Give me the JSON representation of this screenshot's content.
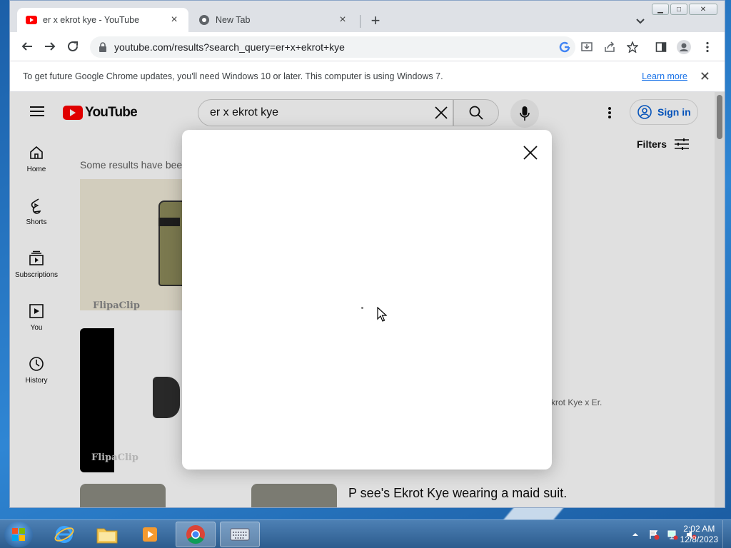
{
  "browser": {
    "tabs": [
      {
        "title": "er x ekrot kye - YouTube",
        "active": true
      },
      {
        "title": "New Tab",
        "active": false
      }
    ],
    "address": "youtube.com/results?search_query=er+x+ekrot+kye",
    "infobar": {
      "message": "To get future Google Chrome updates, you'll need Windows 10 or later. This computer is using Windows 7.",
      "link": "Learn more"
    }
  },
  "youtube": {
    "logo": "YouTube",
    "search_value": "er x ekrot kye",
    "sign_in": "Sign in",
    "filters": "Filters",
    "guide": [
      {
        "label": "Home",
        "icon": "home-icon"
      },
      {
        "label": "Shorts",
        "icon": "shorts-icon"
      },
      {
        "label": "Subscriptions",
        "icon": "subscriptions-icon"
      },
      {
        "label": "You",
        "icon": "you-icon"
      },
      {
        "label": "History",
        "icon": "history-icon"
      }
    ],
    "notice": "Some results have been",
    "watermark1": "FlipaClip",
    "watermark2": "FlipaClip",
    "snippet": "krot Kye x Er.",
    "video_title": "P see's Ekrot Kye wearing a maid suit."
  },
  "taskbar": {
    "time": "2:02 AM",
    "date": "12/8/2023",
    "apps": [
      "internet-explorer",
      "file-explorer",
      "media-player",
      "chrome",
      "on-screen-keyboard"
    ]
  },
  "colors": {
    "yt_red": "#ff0000",
    "link_blue": "#1a73e8",
    "signin_blue": "#065fd4"
  }
}
